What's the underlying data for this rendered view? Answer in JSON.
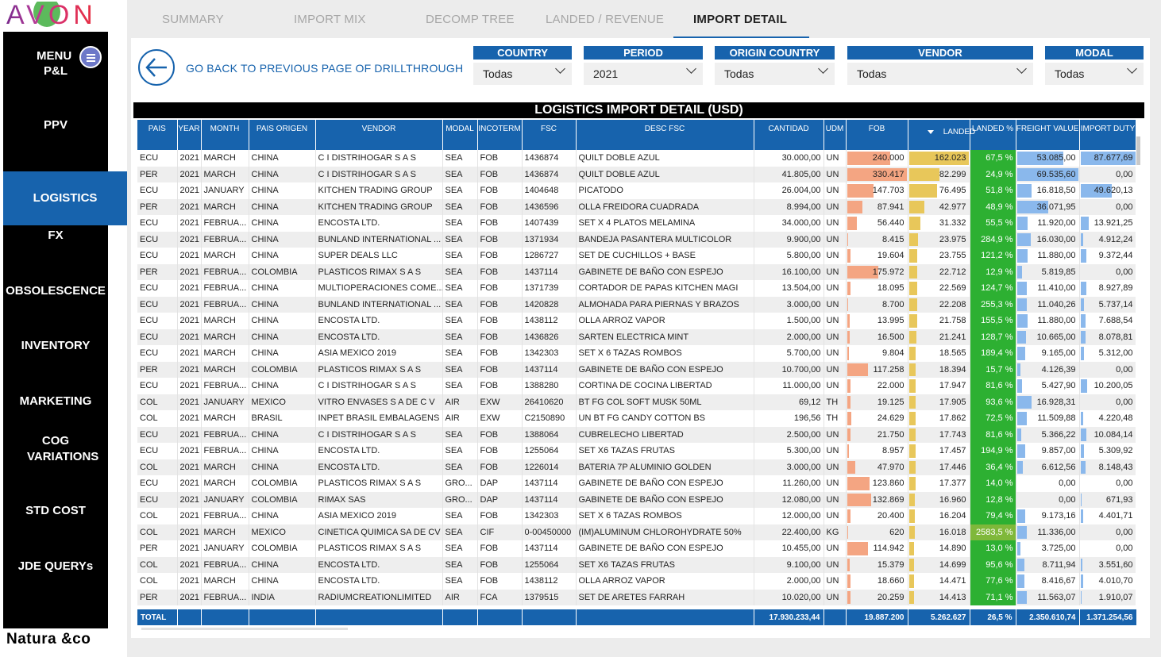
{
  "brand": {
    "logo": "AVON",
    "footer_logo": "Natura &co"
  },
  "menu": {
    "label": "MENU"
  },
  "nav": [
    "P&L",
    "PPV",
    "LOGISTICS",
    "FX",
    "OBSOLESCENCE",
    "INVENTORY",
    "MARKETING",
    "COG VARIATIONS",
    "STD COST",
    "JDE QUERYs"
  ],
  "nav_active": "LOGISTICS",
  "tabs": [
    "SUMMARY",
    "IMPORT MIX",
    "DECOMP TREE",
    "LANDED / REVENUE",
    "IMPORT DETAIL"
  ],
  "tab_active": "IMPORT DETAIL",
  "back_label": "GO BACK TO PREVIOUS PAGE OF DRILLTHROUGH",
  "filters": [
    {
      "label": "COUNTRY",
      "value": "Todas"
    },
    {
      "label": "PERIOD",
      "value": "2021"
    },
    {
      "label": "ORIGIN COUNTRY",
      "value": "Todas"
    },
    {
      "label": "VENDOR",
      "value": "Todas"
    },
    {
      "label": "MODAL",
      "value": "Todas"
    }
  ],
  "table_title": "LOGISTICS IMPORT DETAIL (USD)",
  "columns": [
    "PAIS",
    "YEAR",
    "MONTH",
    "PAIS ORIGEN",
    "VENDOR",
    "MODAL",
    "INCOTERM",
    "FSC",
    "DESC FSC",
    "CANTIDAD",
    "UDM",
    "FOB",
    "LANDED",
    "LANDED %",
    "FREIGHT VALUE",
    "IMPORT DUTY"
  ],
  "colors": {
    "accent": "#1763ad",
    "fob_bar": "#f4a582",
    "landed_bar": "#e8c75a",
    "landed_pct": "#2db032",
    "freight_bar": "#8ab8ec"
  },
  "rows": [
    [
      "ECU",
      "2021",
      "MARCH",
      "CHINA",
      "C I DISTRIHOGAR S A S",
      "SEA",
      "FOB",
      "1436874",
      "QUILT DOBLE AZUL",
      "30.000,00",
      "UN",
      "240.000",
      "162.023",
      "67,5 %",
      "53.085,00",
      "87.677,69"
    ],
    [
      "PER",
      "2021",
      "MARCH",
      "CHINA",
      "C I DISTRIHOGAR S A S",
      "SEA",
      "FOB",
      "1436874",
      "QUILT DOBLE AZUL",
      "41.805,00",
      "UN",
      "330.417",
      "82.299",
      "24,9 %",
      "69.535,60",
      "0,00"
    ],
    [
      "ECU",
      "2021",
      "JANUARY",
      "CHINA",
      "KITCHEN TRADING GROUP",
      "SEA",
      "FOB",
      "1404648",
      "PICATODO",
      "26.004,00",
      "UN",
      "147.703",
      "76.495",
      "51,8 %",
      "16.818,50",
      "49.620,13"
    ],
    [
      "PER",
      "2021",
      "MARCH",
      "CHINA",
      "KITCHEN TRADING GROUP",
      "SEA",
      "FOB",
      "1436596",
      "OLLA FREIDORA CUADRADA",
      "8.994,00",
      "UN",
      "87.941",
      "42.977",
      "48,9 %",
      "36.071,95",
      "0,00"
    ],
    [
      "ECU",
      "2021",
      "FEBRUA...",
      "CHINA",
      "ENCOSTA LTD.",
      "SEA",
      "FOB",
      "1407439",
      "SET X 4 PLATOS MELAMINA",
      "34.000,00",
      "UN",
      "56.440",
      "31.332",
      "55,5 %",
      "11.920,00",
      "13.921,25"
    ],
    [
      "ECU",
      "2021",
      "FEBRUA...",
      "CHINA",
      "BUNLAND INTERNATIONAL ...",
      "SEA",
      "FOB",
      "1371934",
      "BANDEJA PASANTERA MULTICOLOR",
      "9.900,00",
      "UN",
      "8.415",
      "23.975",
      "284,9 %",
      "16.030,00",
      "4.912,24"
    ],
    [
      "ECU",
      "2021",
      "MARCH",
      "CHINA",
      "SUPER DEALS LLC",
      "SEA",
      "FOB",
      "1286727",
      "SET DE CUCHILLOS + BASE",
      "5.800,00",
      "UN",
      "19.604",
      "23.755",
      "121,2 %",
      "11.880,00",
      "9.372,44"
    ],
    [
      "PER",
      "2021",
      "FEBRUA...",
      "COLOMBIA",
      "PLASTICOS RIMAX S A S",
      "SEA",
      "FOB",
      "1437114",
      "GABINETE DE BAÑO CON ESPEJO",
      "16.100,00",
      "UN",
      "175.972",
      "22.712",
      "12,9 %",
      "5.819,85",
      "0,00"
    ],
    [
      "ECU",
      "2021",
      "FEBRUA...",
      "CHINA",
      "MULTIOPERACIONES COME...",
      "SEA",
      "FOB",
      "1371739",
      "CORTADOR DE PAPAS KITCHEN MAGI",
      "13.504,00",
      "UN",
      "18.095",
      "22.569",
      "124,7 %",
      "11.410,00",
      "8.927,89"
    ],
    [
      "ECU",
      "2021",
      "FEBRUA...",
      "CHINA",
      "BUNLAND INTERNATIONAL ...",
      "SEA",
      "FOB",
      "1420828",
      "ALMOHADA PARA PIERNAS Y BRAZOS",
      "3.000,00",
      "UN",
      "8.700",
      "22.208",
      "255,3 %",
      "11.040,26",
      "5.737,14"
    ],
    [
      "ECU",
      "2021",
      "MARCH",
      "CHINA",
      "ENCOSTA LTD.",
      "SEA",
      "FOB",
      "1438112",
      "OLLA ARROZ VAPOR",
      "1.500,00",
      "UN",
      "13.995",
      "21.758",
      "155,5 %",
      "11.880,00",
      "7.688,54"
    ],
    [
      "ECU",
      "2021",
      "MARCH",
      "CHINA",
      "ENCOSTA LTD.",
      "SEA",
      "FOB",
      "1436826",
      "SARTEN ELECTRICA MINT",
      "2.000,00",
      "UN",
      "16.500",
      "21.241",
      "128,7 %",
      "10.665,00",
      "8.078,81"
    ],
    [
      "ECU",
      "2021",
      "MARCH",
      "CHINA",
      "ASIA MEXICO 2019",
      "SEA",
      "FOB",
      "1342303",
      "SET X 6 TAZAS ROMBOS",
      "5.700,00",
      "UN",
      "9.804",
      "18.565",
      "189,4 %",
      "9.165,00",
      "5.312,00"
    ],
    [
      "PER",
      "2021",
      "MARCH",
      "COLOMBIA",
      "PLASTICOS RIMAX S A S",
      "SEA",
      "FOB",
      "1437114",
      "GABINETE DE BAÑO CON ESPEJO",
      "10.700,00",
      "UN",
      "117.258",
      "18.394",
      "15,7 %",
      "4.126,39",
      "0,00"
    ],
    [
      "ECU",
      "2021",
      "FEBRUA...",
      "CHINA",
      "C I  DISTRIHOGAR S A S",
      "SEA",
      "FOB",
      "1388280",
      "CORTINA DE COCINA LIBERTAD",
      "11.000,00",
      "UN",
      "22.000",
      "17.947",
      "81,6 %",
      "5.427,90",
      "10.200,05"
    ],
    [
      "COL",
      "2021",
      "JANUARY",
      "MEXICO",
      "VITRO ENVASES S A DE C V",
      "AIR",
      "EXW",
      "26410620",
      "BT FG COL SOFT MUSK 50ML",
      "69,12",
      "TH",
      "19.125",
      "17.905",
      "93,6 %",
      "16.928,31",
      "0,00"
    ],
    [
      "COL",
      "2021",
      "MARCH",
      "BRASIL",
      "INPET BRASIL EMBALAGENS ...",
      "AIR",
      "EXW",
      "C2150890",
      "UN BT FG CANDY COTTON BS",
      "196,56",
      "TH",
      "24.629",
      "17.862",
      "72,5 %",
      "11.509,88",
      "4.220,48"
    ],
    [
      "ECU",
      "2021",
      "FEBRUA...",
      "CHINA",
      "C I  DISTRIHOGAR S A S",
      "SEA",
      "FOB",
      "1388064",
      "CUBRELECHO LIBERTAD",
      "2.500,00",
      "UN",
      "21.750",
      "17.743",
      "81,6 %",
      "5.366,22",
      "10.084,14"
    ],
    [
      "ECU",
      "2021",
      "FEBRUA...",
      "CHINA",
      "ENCOSTA LTD.",
      "SEA",
      "FOB",
      "1255064",
      "SET X6 TAZAS FRUTAS",
      "5.300,00",
      "UN",
      "8.957",
      "17.457",
      "194,9 %",
      "9.857,00",
      "5.309,92"
    ],
    [
      "COL",
      "2021",
      "MARCH",
      "CHINA",
      "ENCOSTA LTD.",
      "SEA",
      "FOB",
      "1226014",
      "BATERIA 7P ALUMINIO GOLDEN",
      "3.000,00",
      "UN",
      "47.970",
      "17.446",
      "36,4 %",
      "6.612,56",
      "8.148,43"
    ],
    [
      "ECU",
      "2021",
      "MARCH",
      "COLOMBIA",
      "PLASTICOS RIMAX S A S",
      "GRO...",
      "DAP",
      "1437114",
      "GABINETE DE BAÑO CON ESPEJO",
      "11.260,00",
      "UN",
      "123.860",
      "17.377",
      "14,0 %",
      "0,00",
      "0,00"
    ],
    [
      "ECU",
      "2021",
      "JANUARY",
      "COLOMBIA",
      "RIMAX SAS",
      "GRO...",
      "DAP",
      "1437114",
      "GABINETE DE BAÑO CON ESPEJO",
      "12.080,00",
      "UN",
      "132.869",
      "16.960",
      "12,8 %",
      "0,00",
      "671,93"
    ],
    [
      "COL",
      "2021",
      "FEBRUA...",
      "CHINA",
      "ASIA MEXICO 2019",
      "SEA",
      "FOB",
      "1342303",
      "SET X 6 TAZAS ROMBOS",
      "12.000,00",
      "UN",
      "20.400",
      "16.204",
      "79,4 %",
      "9.173,16",
      "4.401,71"
    ],
    [
      "COL",
      "2021",
      "MARCH",
      "MEXICO",
      "CINETICA QUIMICA SA DE CV",
      "SEA",
      "CIF",
      "0-00450000",
      "(IM)ALUMINUM CHLOROHYDRATE 50%",
      "22.400,00",
      "KG",
      "620",
      "16.018",
      "2583,5 %",
      "11.336,00",
      "0,00"
    ],
    [
      "PER",
      "2021",
      "JANUARY",
      "COLOMBIA",
      "PLASTICOS RIMAX S A S",
      "SEA",
      "FOB",
      "1437114",
      "GABINETE DE BAÑO CON ESPEJO",
      "10.455,00",
      "UN",
      "114.942",
      "14.890",
      "13,0 %",
      "3.725,00",
      "0,00"
    ],
    [
      "COL",
      "2021",
      "FEBRUA...",
      "CHINA",
      "ENCOSTA LTD.",
      "SEA",
      "FOB",
      "1255064",
      "SET X6 TAZAS FRUTAS",
      "9.100,00",
      "UN",
      "15.379",
      "14.699",
      "95,6 %",
      "8.711,94",
      "3.551,60"
    ],
    [
      "COL",
      "2021",
      "MARCH",
      "CHINA",
      "ENCOSTA LTD.",
      "SEA",
      "FOB",
      "1438112",
      "OLLA ARROZ VAPOR",
      "2.000,00",
      "UN",
      "18.660",
      "14.471",
      "77,6 %",
      "8.416,67",
      "4.010,70"
    ],
    [
      "PER",
      "2021",
      "FEBRUA...",
      "INDIA",
      "RADIUMCREATIONLIMITED",
      "AIR",
      "FCA",
      "1379515",
      "SET DE ARETES FARRAH",
      "10.020,00",
      "UN",
      "20.259",
      "14.413",
      "71,1 %",
      "11.563,07",
      "1.910,07"
    ]
  ],
  "totals": {
    "label": "TOTAL",
    "cantidad": "17.930.233,44",
    "fob": "19.887.200",
    "landed": "5.262.627",
    "landed_pct": "26,5 %",
    "freight": "2.350.610,74",
    "duty": "1.371.254,56"
  }
}
